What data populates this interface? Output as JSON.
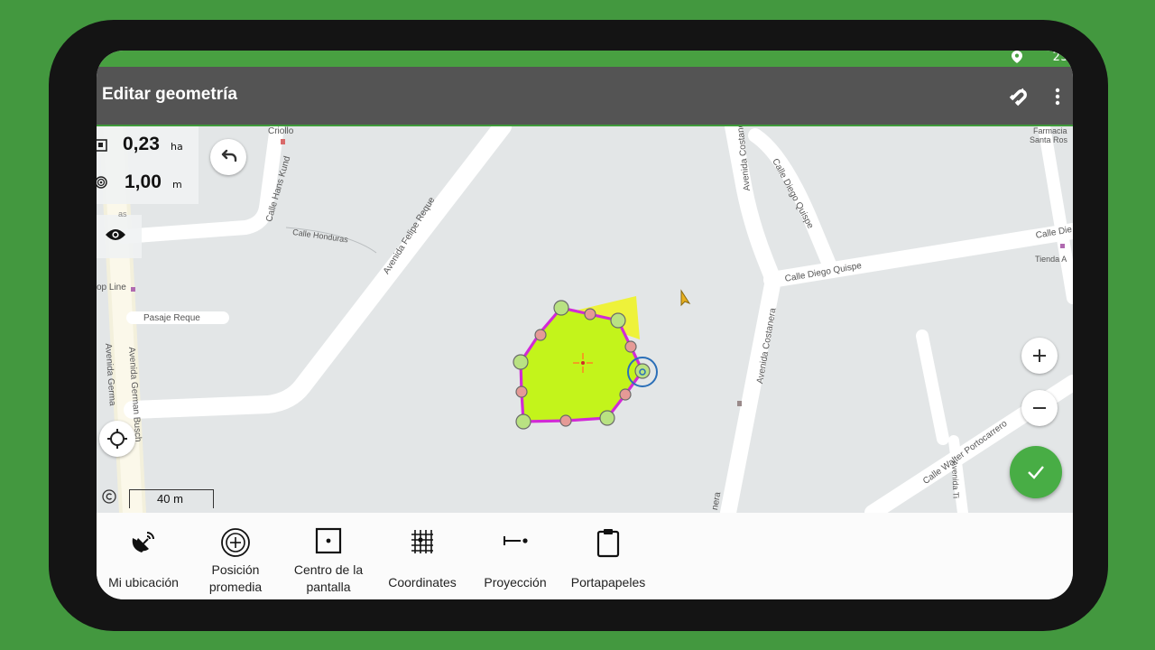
{
  "status": {
    "time": "23:"
  },
  "appbar": {
    "title": "Editar geometría"
  },
  "measure": {
    "area_value": "0,23",
    "area_unit": "ha",
    "accuracy_value": "1,00",
    "accuracy_unit": "m"
  },
  "map": {
    "scale_label": "40 m",
    "streets": {
      "criollo": "Criollo",
      "hans_kund": "Calle Hans Kund",
      "honduras": "Calle Honduras",
      "felipe_reque": "Avenida Felipe Reque",
      "costanera_top": "Avenida Costanera",
      "diego_quispe_v": "Calle Diego Quispe",
      "diego_quispe_h": "Calle Diego Quispe",
      "calle_die": "Calle Die",
      "farmacia": "Farmacia",
      "santa_rosa": "Santa Ros",
      "tienda": "Tienda A",
      "shop_line": "op Line",
      "pasaje_reque": "Pasaje Reque",
      "german1": "Avenida Germa",
      "german2": "Avenida German Busch",
      "costanera_mid": "Avenida Costanera",
      "walter": "Calle Walter Portocarrero",
      "avenida_ti": "Avenida Ti",
      "nera": "nera",
      "as": "as"
    }
  },
  "toolbar": {
    "my_location": "Mi ubicación",
    "avg_pos_1": "Posición",
    "avg_pos_2": "promedia",
    "center_1": "Centro de la",
    "center_2": "pantalla",
    "coordinates": "Coordinates",
    "projection": "Proyección",
    "clipboard": "Portapapeles"
  },
  "colors": {
    "polygon_fill": "#c3f41b",
    "polygon_stroke": "#d22ad6",
    "vertex": "#b9e282",
    "midpoint": "#e59a96",
    "appbar": "#545454",
    "accent": "#48ad45"
  }
}
